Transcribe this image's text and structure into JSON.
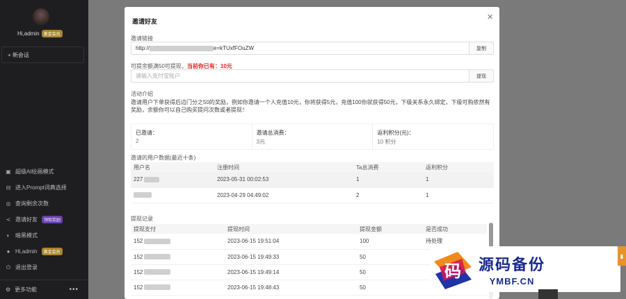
{
  "sidebar": {
    "username": "Hi,admin",
    "vip_badge": "黄金会员",
    "new_chat": "+ 新会话",
    "items": [
      {
        "icon": "image-icon",
        "label": "超级AI绘画模式"
      },
      {
        "icon": "prompt-icon",
        "label": "进入Prompt词典选择"
      },
      {
        "icon": "coin-icon",
        "label": "查询剩余次数"
      },
      {
        "icon": "share-icon",
        "label": "邀请好友",
        "badge": "领取奖励"
      },
      {
        "icon": "moon-icon",
        "label": "暗黑模式"
      },
      {
        "icon": "user-icon",
        "label": "Hi,admin",
        "badge": "黄金会员"
      },
      {
        "icon": "logout-icon",
        "label": "退出登录"
      }
    ],
    "footer_label": "更多功能",
    "footer_dots": "•••"
  },
  "modal": {
    "title": "邀请好友",
    "close": "×",
    "link_label": "邀请链接",
    "link_prefix": "http://",
    "link_suffix": "e=kTUxfFOuZW",
    "copy_btn": "复制",
    "withdraw_label": "可提余额满50可提现，",
    "withdraw_current": "当前你已有：",
    "withdraw_amount": "10元",
    "alipay_placeholder": "请输入支付宝账户",
    "withdraw_btn": "提现",
    "activity_title": "活动介绍",
    "activity_desc": "邀请用户下单获得后边门分之50的奖励，例如你邀请一个人充值10元，你将获得5元，充值100你就获得50元，下级关系永久绑定，下级可购依然有奖励，余额你可以自己购买提问次数或者提现！",
    "stats": [
      {
        "k": "已邀请：",
        "v": "2"
      },
      {
        "k": "邀请总消费：",
        "v": "3元"
      },
      {
        "k": "返利积分(元)：",
        "v": "10 积分"
      }
    ],
    "invite_table_title": "邀请的用户数据(最近十条)",
    "invite_headers": [
      "用户名",
      "注册时间",
      "Ta总消费",
      "返利积分"
    ],
    "invite_rows": [
      [
        "227",
        "2023-05-31 00:02:53",
        "1",
        "1"
      ],
      [
        "",
        "2023-04-29 04:49:02",
        "2",
        "1"
      ]
    ],
    "withdraw_table_title": "提现记录",
    "withdraw_headers": [
      "提现支付",
      "提现时间",
      "提现金额",
      "是否成功"
    ],
    "withdraw_rows": [
      [
        "152",
        "2023-06-15 19:51:04",
        "100",
        "待处理"
      ],
      [
        "152",
        "2023-06-15 19:49:33",
        "50",
        ""
      ],
      [
        "152",
        "2023-06-15 19:49:14",
        "50",
        ""
      ],
      [
        "152",
        "2023-06-15 19:48:43",
        "50",
        ""
      ]
    ]
  },
  "watermark": {
    "glyph": "码",
    "cn": "源码备份",
    "en": "YMBF.CN"
  }
}
